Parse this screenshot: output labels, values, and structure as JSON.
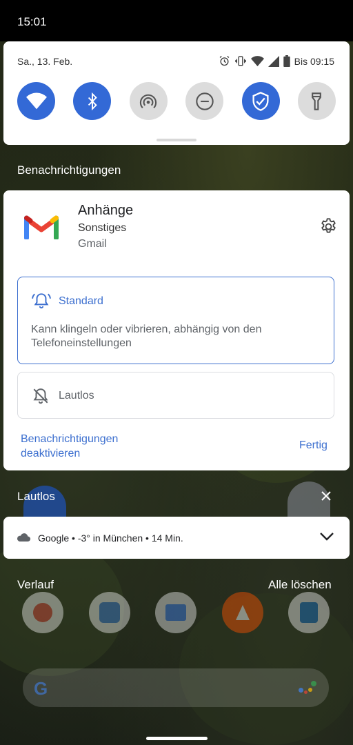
{
  "status_bar": {
    "time": "15:01"
  },
  "quick_settings": {
    "date": "Sa., 13. Feb.",
    "battery_text": "Bis 09:15",
    "tiles": [
      {
        "name": "wifi",
        "state": "on",
        "icon": "wifi-icon"
      },
      {
        "name": "bluetooth",
        "state": "on",
        "icon": "bluetooth-icon"
      },
      {
        "name": "hotspot",
        "state": "off",
        "icon": "hotspot-icon"
      },
      {
        "name": "do-not-disturb",
        "state": "off",
        "icon": "minus-circle-icon"
      },
      {
        "name": "shield",
        "state": "on",
        "icon": "shield-check-icon"
      },
      {
        "name": "flashlight",
        "state": "off",
        "icon": "flashlight-icon"
      }
    ],
    "colors": {
      "active": "#3369d6",
      "inactive": "#dcdcdc"
    }
  },
  "notifications_label": "Benachrichtigungen",
  "notification_settings": {
    "title": "Anhänge",
    "category": "Sonstiges",
    "app": "Gmail",
    "standard": {
      "title": "Standard",
      "description": "Kann klingeln oder vibrieren, abhängig von den Telefoneinstellungen"
    },
    "silent": {
      "title": "Lautlos"
    },
    "disable_link": "Benachrichtigungen deaktivieren",
    "done_button": "Fertig",
    "accent_color": "#3c6fcf"
  },
  "silent_section": {
    "label": "Lautlos"
  },
  "weather_notification": {
    "text": "Google • -3° in München • 14 Min."
  },
  "history": {
    "label": "Verlauf",
    "clear_all": "Alle löschen"
  }
}
